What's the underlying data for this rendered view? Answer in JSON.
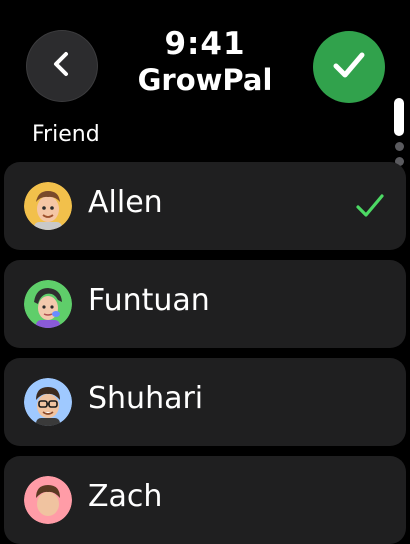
{
  "header": {
    "time": "9:41",
    "title": "GrowPal",
    "back_icon": "chevron-left-icon",
    "confirm_icon": "checkmark-icon"
  },
  "section": {
    "label": "Friend"
  },
  "friends": [
    {
      "name": "Allen",
      "avatar_bg": "#f2c04b",
      "selected": true
    },
    {
      "name": "Funtuan",
      "avatar_bg": "#5fce6a",
      "selected": false
    },
    {
      "name": "Shuhari",
      "avatar_bg": "#9fc9ff",
      "selected": false
    },
    {
      "name": "Zach",
      "avatar_bg": "#ff9ca7",
      "selected": false
    }
  ],
  "colors": {
    "accent_green": "#31a24c",
    "check_green": "#4cd964",
    "row_bg": "#1f1f20"
  }
}
